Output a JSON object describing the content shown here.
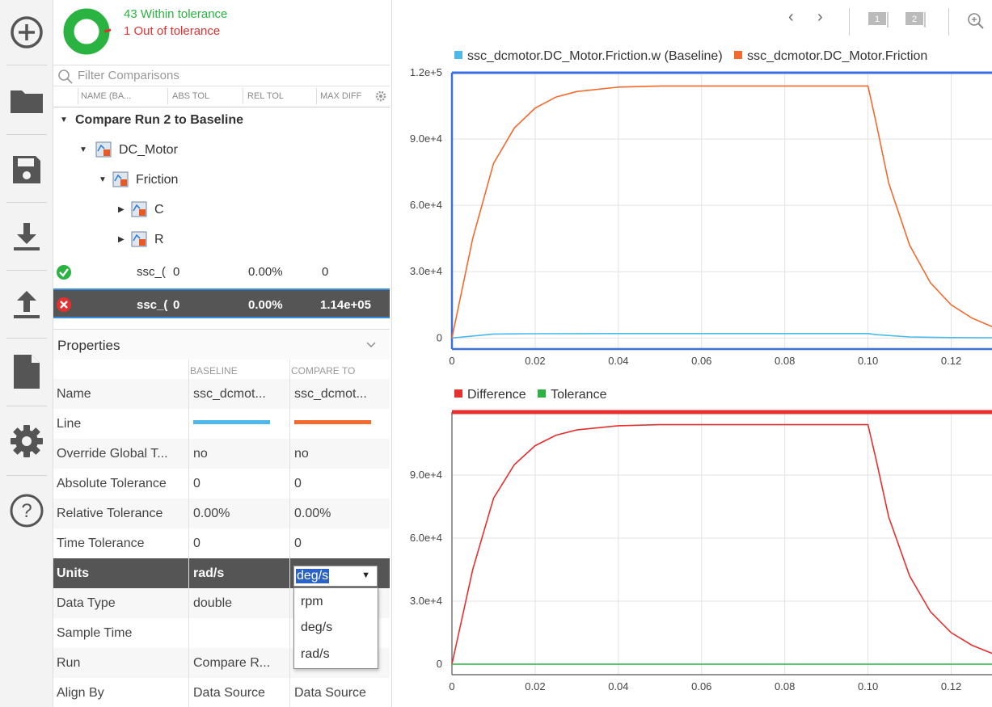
{
  "summary": {
    "within": "43 Within tolerance",
    "out": "1 Out of tolerance",
    "within_count": 43,
    "out_count": 1,
    "colors": {
      "within": "#2ab340",
      "out": "#e53030"
    }
  },
  "filter": {
    "placeholder": "Filter Comparisons"
  },
  "columns": [
    "NAME (BA...",
    "ABS TOL",
    "REL TOL",
    "MAX DIFF"
  ],
  "tree": {
    "root": "Compare Run 2 to Baseline",
    "dc_motor": "DC_Motor",
    "friction": "Friction",
    "c": "C",
    "r": "R"
  },
  "rows": [
    {
      "name": "ssc_(",
      "abs_tol": "0",
      "rel_tol": "0.00%",
      "max_diff": "0",
      "status": "pass"
    },
    {
      "name": "ssc_(",
      "abs_tol": "0",
      "rel_tol": "0.00%",
      "max_diff": "1.14e+05",
      "status": "fail"
    }
  ],
  "properties": {
    "title": "Properties",
    "baseline_header": "BASELINE",
    "compare_header": "COMPARE TO",
    "items": [
      {
        "label": "Name",
        "baseline": "ssc_dcmot...",
        "compare": "ssc_dcmot..."
      },
      {
        "label": "Line",
        "baseline": "",
        "compare": ""
      },
      {
        "label": "Override Global T...",
        "baseline": "no",
        "compare": "no"
      },
      {
        "label": "Absolute Tolerance",
        "baseline": "0",
        "compare": "0"
      },
      {
        "label": "Relative Tolerance",
        "baseline": "0.00%",
        "compare": "0.00%"
      },
      {
        "label": "Time Tolerance",
        "baseline": "0",
        "compare": "0"
      },
      {
        "label": "Units",
        "baseline": "rad/s",
        "compare": "deg/s"
      },
      {
        "label": "Data Type",
        "baseline": "double",
        "compare": ""
      },
      {
        "label": "Sample Time",
        "baseline": "",
        "compare": ""
      },
      {
        "label": "Run",
        "baseline": "Compare R...",
        "compare": ""
      },
      {
        "label": "Align By",
        "baseline": "Data Source",
        "compare": "Data Source"
      }
    ],
    "line_colors": {
      "baseline": "#4db8ea",
      "compare": "#f26a2d"
    },
    "units_options": [
      "rpm",
      "deg/s",
      "rad/s"
    ]
  },
  "toolbar": {
    "icons": [
      "add-icon",
      "folder-icon",
      "save-icon",
      "download-icon",
      "upload-icon",
      "document-icon",
      "gear-icon",
      "help-icon"
    ]
  },
  "nav": {
    "layout_1": "1",
    "layout_2": "2"
  },
  "chart_data": [
    {
      "type": "line",
      "title": "",
      "xlabel": "",
      "ylabel": "",
      "xlim": [
        0,
        0.13
      ],
      "ylim": [
        -5000,
        120000
      ],
      "x_ticks": [
        "0",
        "0.02",
        "0.04",
        "0.06",
        "0.08",
        "0.10",
        "0.12"
      ],
      "y_ticks": [
        "0",
        "3.0e+4",
        "6.0e+4",
        "9.0e+4",
        "1.2e+5"
      ],
      "grid": true,
      "legend": "top",
      "series": [
        {
          "name": "ssc_dcmotor.DC_Motor.Friction.w (Baseline)",
          "color": "#4db8ea",
          "x": [
            0,
            0.01,
            0.02,
            0.04,
            0.06,
            0.08,
            0.1,
            0.102,
            0.11,
            0.12,
            0.13
          ],
          "values": [
            0,
            1800,
            1950,
            2000,
            2000,
            2000,
            2000,
            1500,
            500,
            200,
            100
          ]
        },
        {
          "name": "ssc_dcmotor.DC_Motor.Friction",
          "color": "#f26a2d",
          "x": [
            0,
            0.005,
            0.01,
            0.015,
            0.02,
            0.025,
            0.03,
            0.04,
            0.05,
            0.06,
            0.08,
            0.1,
            0.102,
            0.105,
            0.11,
            0.115,
            0.12,
            0.125,
            0.13
          ],
          "values": [
            0,
            45000,
            79000,
            95000,
            104000,
            109000,
            111500,
            113500,
            114000,
            114000,
            114000,
            114000,
            97000,
            70000,
            42000,
            25000,
            15000,
            9000,
            5000
          ]
        }
      ]
    },
    {
      "type": "line",
      "title": "",
      "xlabel": "",
      "ylabel": "",
      "xlim": [
        0,
        0.13
      ],
      "ylim": [
        -5000,
        120000
      ],
      "x_ticks": [
        "0",
        "0.02",
        "0.04",
        "0.06",
        "0.08",
        "0.10",
        "0.12"
      ],
      "y_ticks": [
        "0",
        "3.0e+4",
        "6.0e+4",
        "9.0e+4"
      ],
      "grid": true,
      "legend": "top",
      "series": [
        {
          "name": "Difference",
          "color": "#e53030",
          "x": [
            0,
            0.005,
            0.01,
            0.015,
            0.02,
            0.025,
            0.03,
            0.04,
            0.05,
            0.06,
            0.08,
            0.1,
            0.102,
            0.105,
            0.11,
            0.115,
            0.12,
            0.125,
            0.13
          ],
          "values": [
            0,
            45000,
            79000,
            95000,
            104000,
            109000,
            111500,
            113500,
            114000,
            114000,
            114000,
            114000,
            97000,
            70000,
            42000,
            25000,
            15000,
            9000,
            5000
          ]
        },
        {
          "name": "Tolerance",
          "color": "#2ab340",
          "x": [
            0,
            0.13
          ],
          "values": [
            0,
            0
          ]
        }
      ]
    }
  ]
}
